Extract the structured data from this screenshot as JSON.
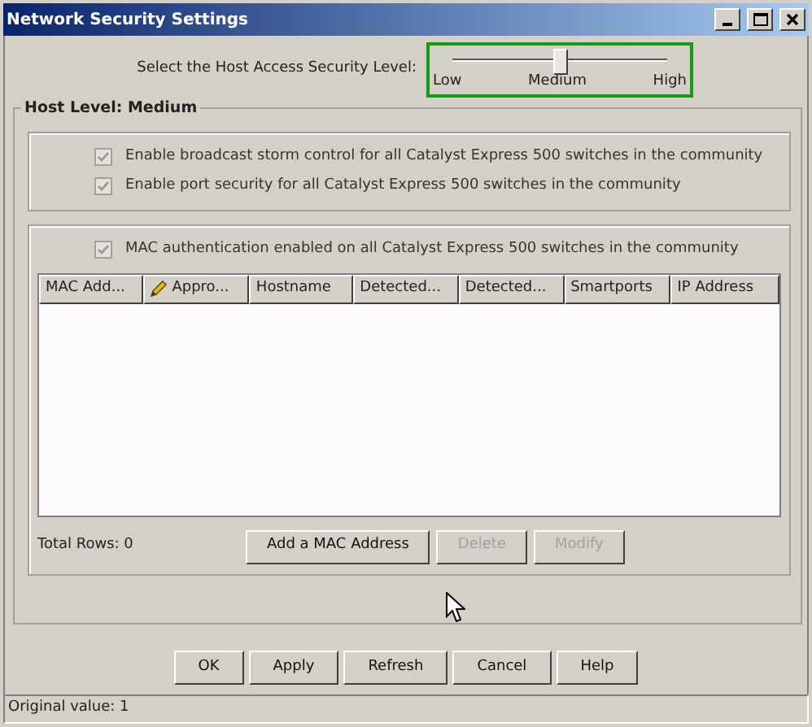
{
  "window": {
    "title": "Network Security Settings"
  },
  "security_level": {
    "label": "Select the Host Access Security Level:",
    "level": 0.5,
    "ticks": [
      "Low",
      "Medium",
      "High"
    ]
  },
  "host_level": {
    "legend": "Host Level: Medium",
    "options": [
      {
        "label": "Enable broadcast storm control for all Catalyst Express 500 switches in the community",
        "checked": true,
        "disabled": true
      },
      {
        "label": "Enable port security for all Catalyst Express 500 switches in the community",
        "checked": true,
        "disabled": true
      }
    ],
    "mac_auth": {
      "label": "MAC authentication enabled on all Catalyst Express 500 switches in the community",
      "checked": true,
      "disabled": true
    },
    "table": {
      "columns": [
        {
          "label": "MAC Add...",
          "kind": "plain"
        },
        {
          "label": "Appro...",
          "kind": "editable"
        },
        {
          "label": "Hostname",
          "kind": "plain"
        },
        {
          "label": "Detected...",
          "kind": "plain"
        },
        {
          "label": "Detected...",
          "kind": "plain"
        },
        {
          "label": "Smartports",
          "kind": "plain"
        },
        {
          "label": "IP Address",
          "kind": "plain"
        }
      ]
    },
    "total_rows": "Total Rows: 0",
    "buttons": [
      {
        "label": "Add a MAC Address",
        "disabled": false
      },
      {
        "label": "Delete",
        "disabled": true
      },
      {
        "label": "Modify",
        "disabled": true
      }
    ]
  },
  "dialog_buttons": [
    {
      "label": "OK",
      "disabled": false
    },
    {
      "label": "Apply",
      "disabled": false
    },
    {
      "label": "Refresh",
      "disabled": false
    },
    {
      "label": "Cancel",
      "disabled": false
    },
    {
      "label": "Help",
      "disabled": false
    }
  ],
  "status_bar": "Original value: 1"
}
